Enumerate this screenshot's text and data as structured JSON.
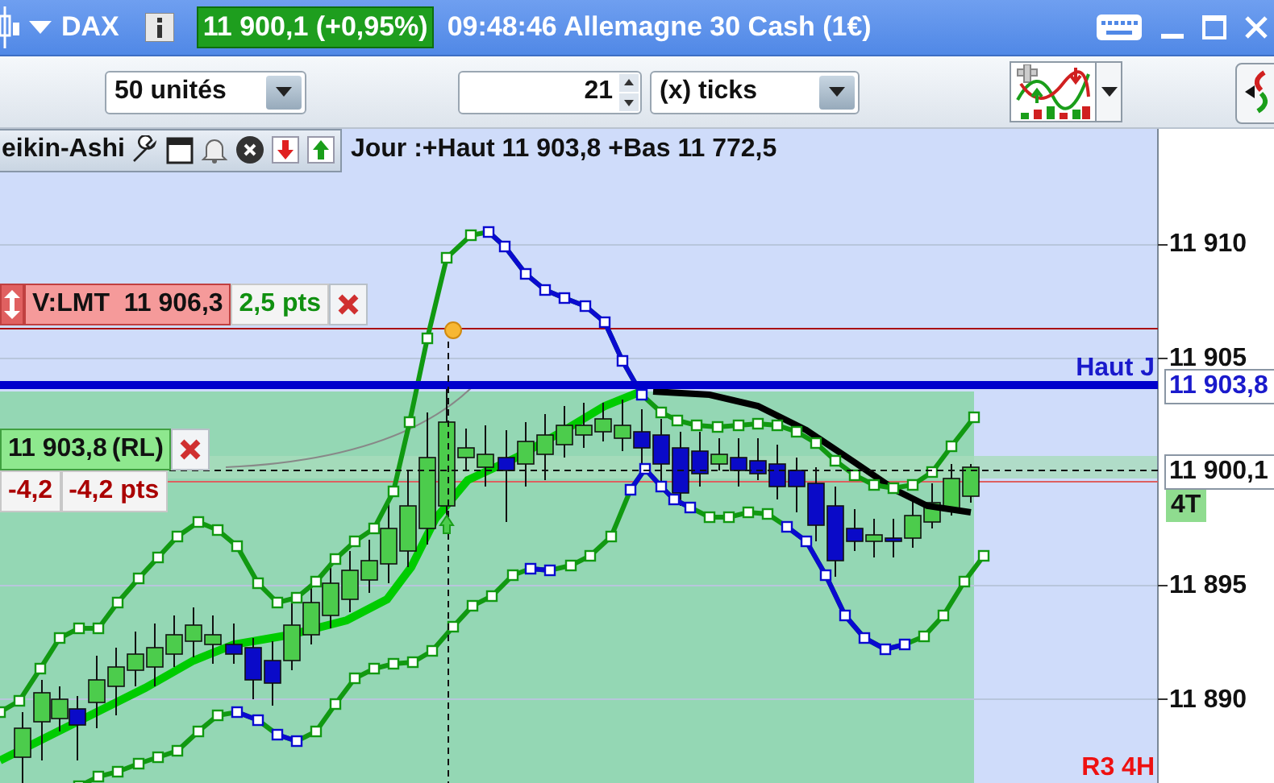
{
  "window": {
    "symbol": "DAX",
    "price": "11 900,1 (+0,95%)",
    "title": "09:48:46 Allemagne 30 Cash (1€)"
  },
  "toolbar": {
    "quantity": "50 unités",
    "ticks_value": "21",
    "ticks_unit": "(x) ticks"
  },
  "legend": {
    "chart_type": "eikin-Ashi",
    "info": "Jour :+Haut 11 903,8 +Bas 11 772,5"
  },
  "orders": [
    {
      "kind": "limit",
      "label": "V:LMT  11 906,3",
      "points": "2,5 pts"
    },
    {
      "kind": "position",
      "label": "11 903,8",
      "tag": "(RL)",
      "pl": "-4,2",
      "points": "-4,2 pts"
    }
  ],
  "axis": {
    "ticks": [
      "11 910",
      "11 905",
      "11 895",
      "11 890"
    ]
  },
  "levels": [
    {
      "kind": "high",
      "label": "Haut J",
      "marker": "11 903,8"
    },
    {
      "kind": "pivot",
      "label": "R3 4H"
    }
  ],
  "price_marker": {
    "value": "11 900,1",
    "countdown": "4T"
  }
}
